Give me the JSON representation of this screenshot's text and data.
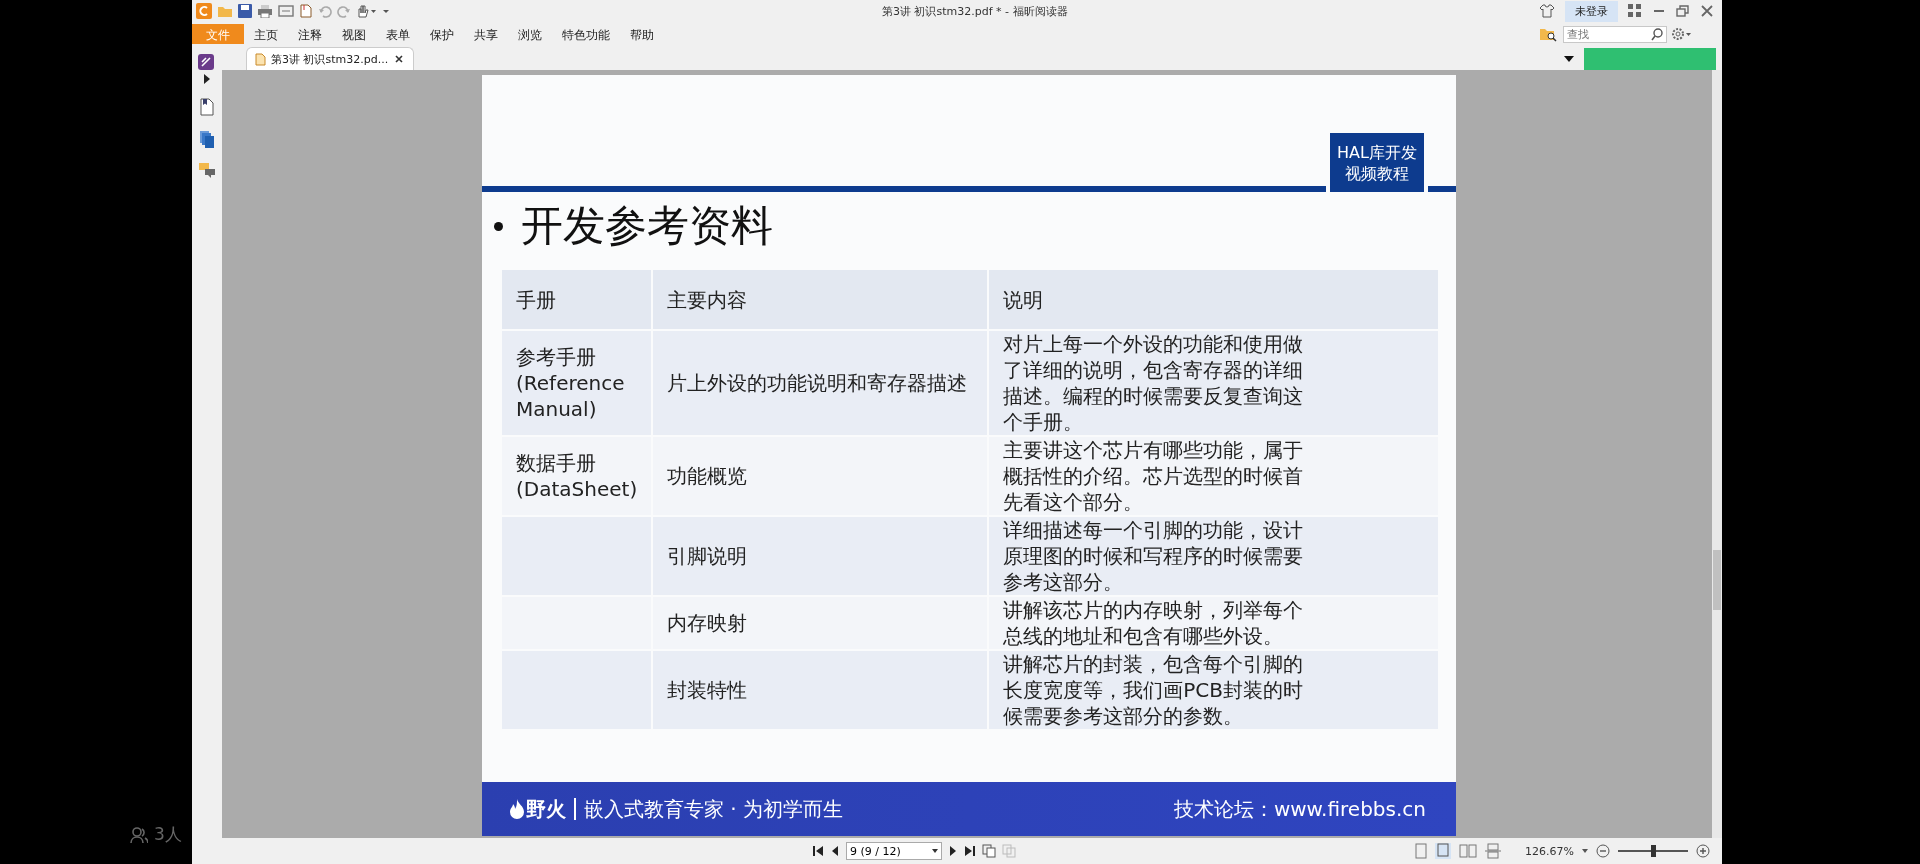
{
  "window": {
    "title": "第3讲 初识stm32.pdf * - 福昕阅读器"
  },
  "account": {
    "label": "未登录"
  },
  "menu": [
    {
      "label": "文件",
      "selected": true
    },
    {
      "label": "主页",
      "selected": false
    },
    {
      "label": "注释",
      "selected": false
    },
    {
      "label": "视图",
      "selected": false
    },
    {
      "label": "表单",
      "selected": false
    },
    {
      "label": "保护",
      "selected": false
    },
    {
      "label": "共享",
      "selected": false
    },
    {
      "label": "浏览",
      "selected": false
    },
    {
      "label": "特色功能",
      "selected": false
    },
    {
      "label": "帮助",
      "selected": false
    }
  ],
  "search": {
    "placeholder": "查找"
  },
  "tabs": [
    {
      "label": "第3讲 初识stm32.pd...",
      "selected": true
    }
  ],
  "slide": {
    "badge": [
      "HAL库开发",
      "视频教程"
    ],
    "title": "开发参考资料",
    "table": {
      "columns": [
        "手册",
        "主要内容",
        "说明"
      ],
      "rows": [
        {
          "manual": "参考手册\n(Reference\nManual)",
          "content": "片上外设的功能说明和寄存器描述",
          "note": "对片上每一个外设的功能和使用做了详细的说明，包含寄存器的详细描述。编程的时候需要反复查询这个手册。"
        },
        {
          "manual": "数据手册\n(DataSheet)",
          "content": "功能概览",
          "note": "主要讲这个芯片有哪些功能，属于概括性的介绍。芯片选型的时候首先看这个部分。"
        },
        {
          "content": "引脚说明",
          "note": "详细描述每一个引脚的功能，设计原理图的时候和写程序的时候需要参考这部分。"
        },
        {
          "content": "内存映射",
          "note": "讲解该芯片的内存映射，列举每个总线的地址和包含有哪些外设。"
        },
        {
          "content": "封装特性",
          "note": "讲解芯片的封装，包含每个引脚的长度宽度等，我们画PCB封装的时候需要参考这部分的参数。"
        }
      ]
    },
    "footer": {
      "brand": "野火",
      "slogan": "嵌入式教育专家 · 为初学而生",
      "forum": "技术论坛：www.firebbs.cn"
    }
  },
  "navigation": {
    "page": "9 (9 / 12)"
  },
  "zoom": {
    "value": "126.67%",
    "level": 0.5
  },
  "overlay": {
    "viewers": "3人"
  }
}
